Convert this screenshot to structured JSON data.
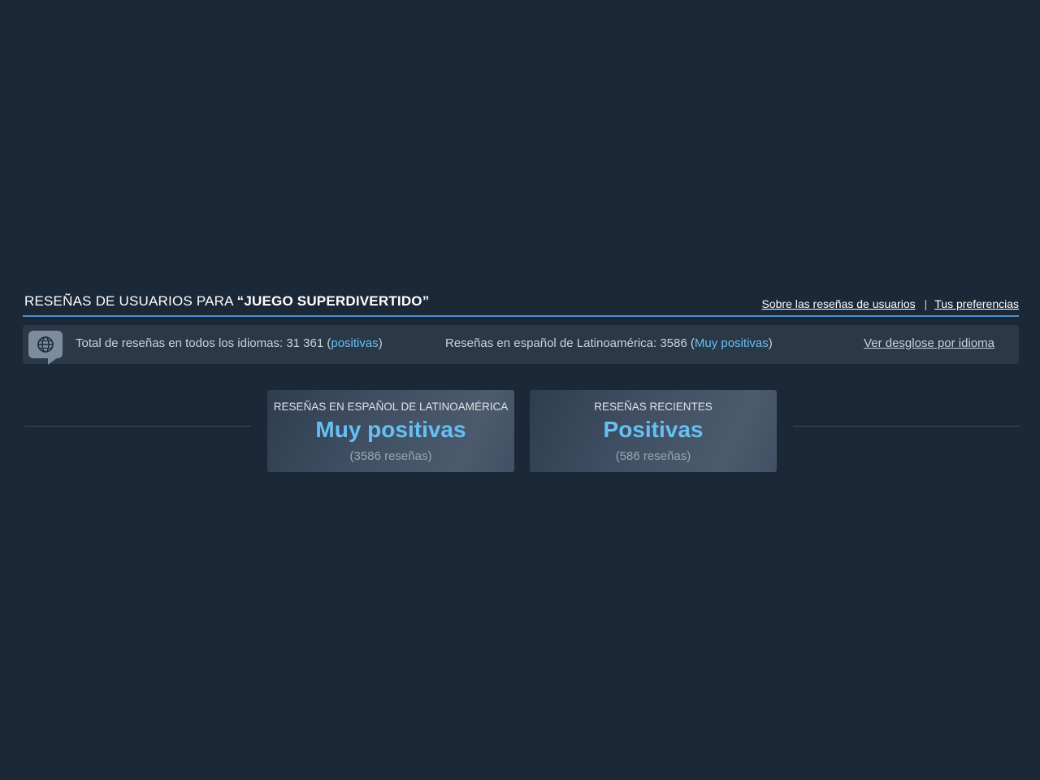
{
  "header": {
    "title_prefix": "RESEÑAS DE USUARIOS PARA ",
    "game_name": "“JUEGO SUPERDIVERTIDO”",
    "about_link": "Sobre las reseñas de usuarios",
    "separator": "|",
    "preferences_link": "Tus preferencias"
  },
  "summary": {
    "icon": "globe-speech-icon",
    "total_prefix": "Total de reseñas en todos los idiomas: 31 361 (",
    "total_rating": "positivas",
    "total_suffix": ")",
    "latam_prefix": "Reseñas en español de Latinoamérica: 3586 (",
    "latam_rating": "Muy positivas",
    "latam_suffix": ")",
    "breakdown_link": "Ver desglose por idioma"
  },
  "boxes": [
    {
      "title": "RESEÑAS EN ESPAÑOL DE LATINOAMÉRICA",
      "rating": "Muy positivas",
      "count": "(3586 reseñas)"
    },
    {
      "title": "RESEÑAS RECIENTES",
      "rating": "Positivas",
      "count": "(586 reseñas)"
    }
  ],
  "colors": {
    "background": "#1b2838",
    "accent": "#66c0f4",
    "header_line": "#4b8fcf"
  }
}
